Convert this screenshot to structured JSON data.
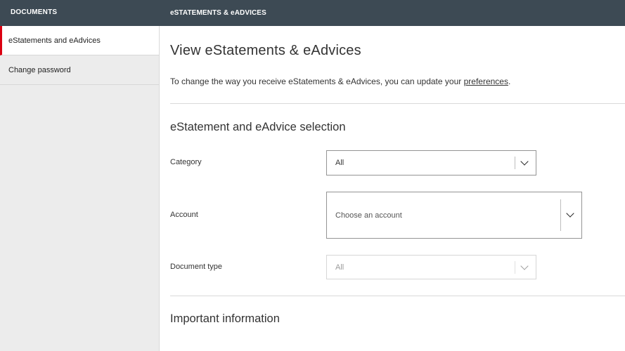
{
  "header": {
    "sidebar_title": "DOCUMENTS",
    "main_title": "eSTATEMENTS & eADVICES",
    "bg_color": "#3d4a54"
  },
  "sidebar": {
    "items": [
      {
        "label": "eStatements and eAdvices",
        "active": true
      },
      {
        "label": "Change password",
        "active": false
      }
    ],
    "active_accent": "#db0011"
  },
  "main": {
    "title": "View eStatements & eAdvices",
    "intro_text": "To change the way you receive eStatements & eAdvices, you can update your ",
    "intro_link": "preferences",
    "intro_end": ".",
    "selection_title": "eStatement and eAdvice selection",
    "fields": {
      "category": {
        "label": "Category",
        "value": "All"
      },
      "account": {
        "label": "Account",
        "placeholder": "Choose an account"
      },
      "document_type": {
        "label": "Document type",
        "value": "All",
        "disabled": true
      }
    },
    "important_title": "Important information"
  }
}
